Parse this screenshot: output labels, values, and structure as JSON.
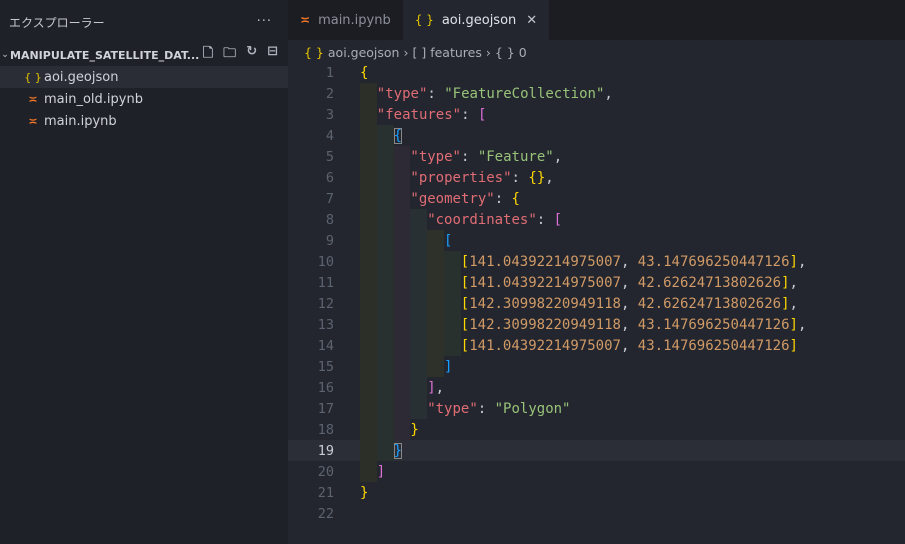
{
  "sidebar": {
    "title": "エクスプローラー",
    "more": "···",
    "folder": "MANIPULATE_SATELLITE_DAT...",
    "files": [
      {
        "name": "aoi.geojson",
        "icon": "json",
        "selected": true
      },
      {
        "name": "main_old.ipynb",
        "icon": "notebook"
      },
      {
        "name": "main.ipynb",
        "icon": "notebook"
      }
    ]
  },
  "tabs": [
    {
      "label": "main.ipynb",
      "icon": "notebook",
      "active": false
    },
    {
      "label": "aoi.geojson",
      "icon": "json",
      "active": true
    }
  ],
  "breadcrumb": [
    "aoi.geojson",
    "features",
    "0"
  ],
  "editor": {
    "current_line": 19,
    "lines": [
      {
        "i": 0,
        "t": [
          [
            "b1",
            "{"
          ]
        ]
      },
      {
        "i": 1,
        "t": [
          [
            "k",
            "\"type\""
          ],
          [
            "p",
            ": "
          ],
          [
            "s",
            "\"FeatureCollection\""
          ],
          [
            "p",
            ","
          ]
        ]
      },
      {
        "i": 1,
        "t": [
          [
            "k",
            "\"features\""
          ],
          [
            "p",
            ": "
          ],
          [
            "b2",
            "["
          ]
        ]
      },
      {
        "i": 2,
        "t": [
          [
            "b3 box",
            "{"
          ]
        ]
      },
      {
        "i": 3,
        "t": [
          [
            "k",
            "\"type\""
          ],
          [
            "p",
            ": "
          ],
          [
            "s",
            "\"Feature\""
          ],
          [
            "p",
            ","
          ]
        ]
      },
      {
        "i": 3,
        "t": [
          [
            "k",
            "\"properties\""
          ],
          [
            "p",
            ": "
          ],
          [
            "b1",
            "{}"
          ],
          [
            "p",
            ","
          ]
        ]
      },
      {
        "i": 3,
        "t": [
          [
            "k",
            "\"geometry\""
          ],
          [
            "p",
            ": "
          ],
          [
            "b1",
            "{"
          ]
        ]
      },
      {
        "i": 4,
        "t": [
          [
            "k",
            "\"coordinates\""
          ],
          [
            "p",
            ": "
          ],
          [
            "b2",
            "["
          ]
        ]
      },
      {
        "i": 5,
        "t": [
          [
            "b3",
            "["
          ]
        ]
      },
      {
        "i": 6,
        "t": [
          [
            "b1",
            "["
          ],
          [
            "n",
            "141.04392214975007"
          ],
          [
            "p",
            ", "
          ],
          [
            "n",
            "43.147696250447126"
          ],
          [
            "b1",
            "]"
          ],
          [
            "p",
            ","
          ]
        ]
      },
      {
        "i": 6,
        "t": [
          [
            "b1",
            "["
          ],
          [
            "n",
            "141.04392214975007"
          ],
          [
            "p",
            ", "
          ],
          [
            "n",
            "42.62624713802626"
          ],
          [
            "b1",
            "]"
          ],
          [
            "p",
            ","
          ]
        ]
      },
      {
        "i": 6,
        "t": [
          [
            "b1",
            "["
          ],
          [
            "n",
            "142.30998220949118"
          ],
          [
            "p",
            ", "
          ],
          [
            "n",
            "42.62624713802626"
          ],
          [
            "b1",
            "]"
          ],
          [
            "p",
            ","
          ]
        ]
      },
      {
        "i": 6,
        "t": [
          [
            "b1",
            "["
          ],
          [
            "n",
            "142.30998220949118"
          ],
          [
            "p",
            ", "
          ],
          [
            "n",
            "43.147696250447126"
          ],
          [
            "b1",
            "]"
          ],
          [
            "p",
            ","
          ]
        ]
      },
      {
        "i": 6,
        "t": [
          [
            "b1",
            "["
          ],
          [
            "n",
            "141.04392214975007"
          ],
          [
            "p",
            ", "
          ],
          [
            "n",
            "43.147696250447126"
          ],
          [
            "b1",
            "]"
          ]
        ]
      },
      {
        "i": 5,
        "t": [
          [
            "b3",
            "]"
          ]
        ]
      },
      {
        "i": 4,
        "t": [
          [
            "b2",
            "]"
          ],
          [
            "p",
            ","
          ]
        ]
      },
      {
        "i": 4,
        "t": [
          [
            "k",
            "\"type\""
          ],
          [
            "p",
            ": "
          ],
          [
            "s",
            "\"Polygon\""
          ]
        ]
      },
      {
        "i": 3,
        "t": [
          [
            "b1",
            "}"
          ]
        ]
      },
      {
        "i": 2,
        "t": [
          [
            "b3 box",
            "}"
          ]
        ]
      },
      {
        "i": 1,
        "t": [
          [
            "b2",
            "]"
          ]
        ]
      },
      {
        "i": 0,
        "t": [
          [
            "b1",
            "}"
          ]
        ]
      },
      {
        "i": 0,
        "t": []
      }
    ]
  }
}
